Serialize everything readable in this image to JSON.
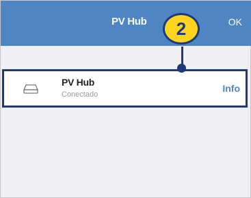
{
  "navbar": {
    "title": "PV Hub",
    "ok_label": "OK",
    "background_color": "#4f85c2"
  },
  "device_list": {
    "rows": [
      {
        "icon": "hard-drive-icon",
        "name": "PV Hub",
        "status": "Conectado",
        "action_label": "Info"
      }
    ]
  },
  "callout": {
    "number": "2",
    "badge_color": "#ffd51e",
    "outline_color": "#1d3a7a"
  }
}
